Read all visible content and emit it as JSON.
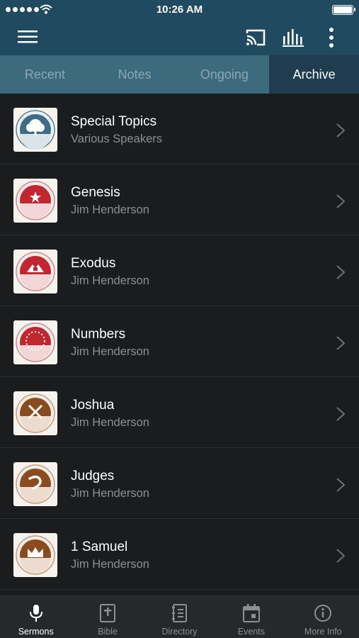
{
  "status_bar": {
    "time": "10:26 AM"
  },
  "toolbar": {
    "menu_icon": "hamburger-menu-icon",
    "cast_icon": "cast-icon",
    "audio_icon": "audio-bars-icon",
    "more_icon": "more-vertical-icon"
  },
  "tabs": [
    {
      "label": "Recent",
      "active": false
    },
    {
      "label": "Notes",
      "active": false
    },
    {
      "label": "Ongoing",
      "active": false
    },
    {
      "label": "Archive",
      "active": true
    }
  ],
  "series": [
    {
      "title": "Special Topics",
      "speaker": "Various Speakers",
      "icon": "tree-icon",
      "color": "#3e6e85"
    },
    {
      "title": "Genesis",
      "speaker": "Jim Henderson",
      "icon": "star-icon",
      "color": "#c2262e"
    },
    {
      "title": "Exodus",
      "speaker": "Jim Henderson",
      "icon": "mountain-icon",
      "color": "#c2262e"
    },
    {
      "title": "Numbers",
      "speaker": "Jim Henderson",
      "icon": "dotted-ring-icon",
      "color": "#c2262e"
    },
    {
      "title": "Joshua",
      "speaker": "Jim Henderson",
      "icon": "crossed-swords-icon",
      "color": "#8a4b1f"
    },
    {
      "title": "Judges",
      "speaker": "Jim Henderson",
      "icon": "horn-icon",
      "color": "#8a4b1f"
    },
    {
      "title": "1 Samuel",
      "speaker": "Jim Henderson",
      "icon": "crown-icon",
      "color": "#8a4b1f"
    }
  ],
  "bottom_nav": [
    {
      "label": "Sermons",
      "icon": "microphone-icon",
      "active": true
    },
    {
      "label": "Bible",
      "icon": "bible-icon",
      "active": false
    },
    {
      "label": "Directory",
      "icon": "directory-icon",
      "active": false
    },
    {
      "label": "Events",
      "icon": "calendar-icon",
      "active": false
    },
    {
      "label": "More Info",
      "icon": "info-icon",
      "active": false
    }
  ]
}
